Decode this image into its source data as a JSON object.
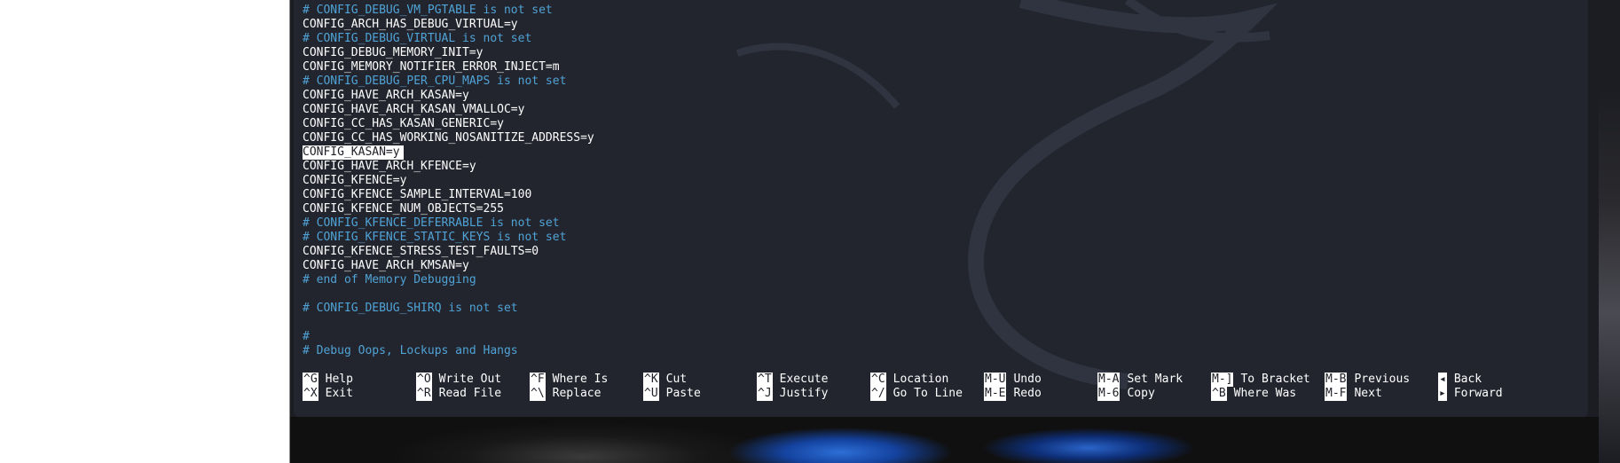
{
  "editor": {
    "lines": [
      {
        "text": "# CONFIG_DEBUG_VM_PGTABLE is not set",
        "type": "comment"
      },
      {
        "text": "CONFIG_ARCH_HAS_DEBUG_VIRTUAL=y",
        "type": "normal"
      },
      {
        "text": "# CONFIG_DEBUG_VIRTUAL is not set",
        "type": "comment"
      },
      {
        "text": "CONFIG_DEBUG_MEMORY_INIT=y",
        "type": "normal"
      },
      {
        "text": "CONFIG_MEMORY_NOTIFIER_ERROR_INJECT=m",
        "type": "normal"
      },
      {
        "text": "# CONFIG_DEBUG_PER_CPU_MAPS is not set",
        "type": "comment"
      },
      {
        "text": "CONFIG_HAVE_ARCH_KASAN=y",
        "type": "normal"
      },
      {
        "text": "CONFIG_HAVE_ARCH_KASAN_VMALLOC=y",
        "type": "normal"
      },
      {
        "text": "CONFIG_CC_HAS_KASAN_GENERIC=y",
        "type": "normal"
      },
      {
        "text": "CONFIG_CC_HAS_WORKING_NOSANITIZE_ADDRESS=y",
        "type": "normal"
      },
      {
        "text": "CONFIG_KASAN=y",
        "type": "cursor"
      },
      {
        "text": "CONFIG_HAVE_ARCH_KFENCE=y",
        "type": "normal"
      },
      {
        "text": "CONFIG_KFENCE=y",
        "type": "normal"
      },
      {
        "text": "CONFIG_KFENCE_SAMPLE_INTERVAL=100",
        "type": "normal"
      },
      {
        "text": "CONFIG_KFENCE_NUM_OBJECTS=255",
        "type": "normal"
      },
      {
        "text": "# CONFIG_KFENCE_DEFERRABLE is not set",
        "type": "comment"
      },
      {
        "text": "# CONFIG_KFENCE_STATIC_KEYS is not set",
        "type": "comment"
      },
      {
        "text": "CONFIG_KFENCE_STRESS_TEST_FAULTS=0",
        "type": "normal"
      },
      {
        "text": "CONFIG_HAVE_ARCH_KMSAN=y",
        "type": "normal"
      },
      {
        "text": "# end of Memory Debugging",
        "type": "comment"
      },
      {
        "text": "",
        "type": "normal"
      },
      {
        "text": "# CONFIG_DEBUG_SHIRQ is not set",
        "type": "comment"
      },
      {
        "text": "",
        "type": "normal"
      },
      {
        "text": "#",
        "type": "comment"
      },
      {
        "text": "# Debug Oops, Lockups and Hangs",
        "type": "comment"
      }
    ]
  },
  "shortcuts": {
    "row1": [
      {
        "key": "^G",
        "label": "Help"
      },
      {
        "key": "^O",
        "label": "Write Out"
      },
      {
        "key": "^F",
        "label": "Where Is"
      },
      {
        "key": "^K",
        "label": "Cut"
      },
      {
        "key": "^T",
        "label": "Execute"
      },
      {
        "key": "^C",
        "label": "Location"
      },
      {
        "key": "M-U",
        "label": "Undo"
      },
      {
        "key": "M-A",
        "label": "Set Mark"
      },
      {
        "key": "M-]",
        "label": "To Bracket"
      },
      {
        "key": "M-B",
        "label": "Previous"
      },
      {
        "key": "◂",
        "label": "Back"
      }
    ],
    "row2": [
      {
        "key": "^X",
        "label": "Exit"
      },
      {
        "key": "^R",
        "label": "Read File"
      },
      {
        "key": "^\\",
        "label": "Replace"
      },
      {
        "key": "^U",
        "label": "Paste"
      },
      {
        "key": "^J",
        "label": "Justify"
      },
      {
        "key": "^/",
        "label": "Go To Line"
      },
      {
        "key": "M-E",
        "label": "Redo"
      },
      {
        "key": "M-6",
        "label": "Copy"
      },
      {
        "key": "^B",
        "label": "Where Was"
      },
      {
        "key": "M-F",
        "label": "Next"
      },
      {
        "key": "▸",
        "label": "Forward"
      }
    ]
  },
  "colors": {
    "background": "#23252e",
    "comment": "#4fa3d6",
    "text": "#ffffff"
  }
}
